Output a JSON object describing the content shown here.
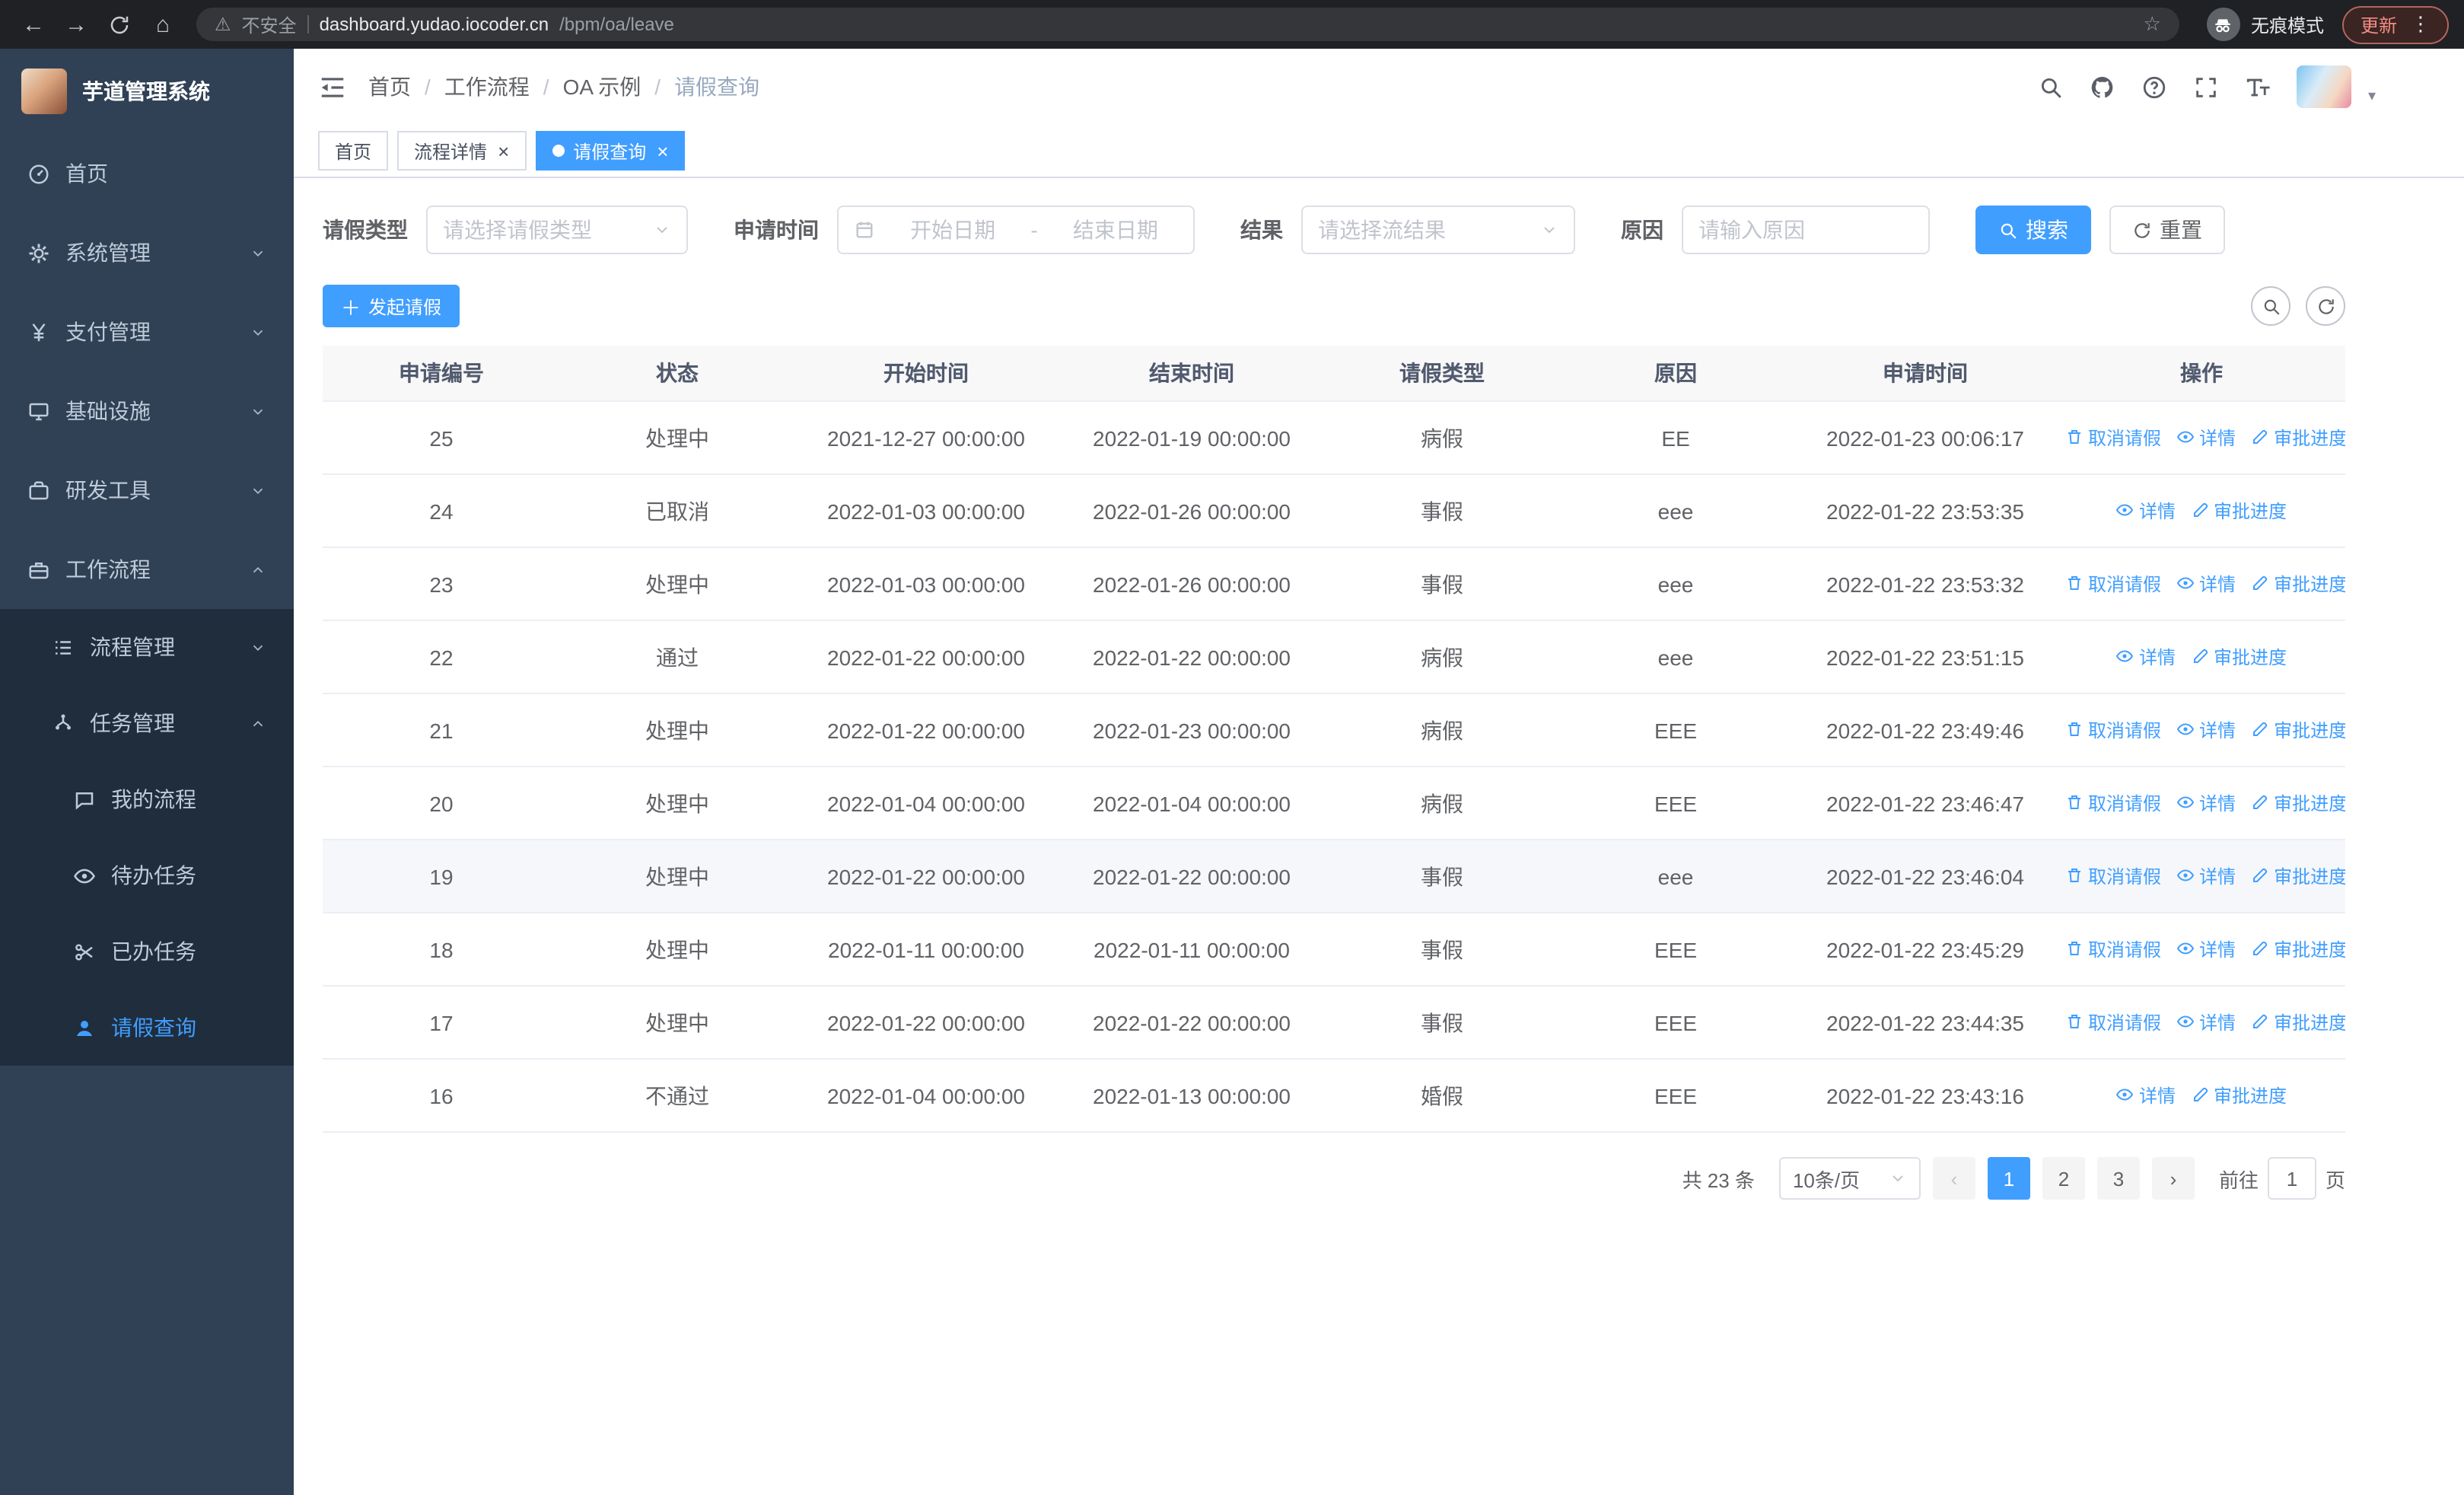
{
  "theme": {
    "primary": "#409eff",
    "sidebar_bg": "#304156",
    "sidebar_submenu_bg": "#1f2d3d",
    "sidebar_text": "#bfcbd9",
    "chrome_bg": "#202124",
    "update_badge_color": "#f28b82"
  },
  "browser": {
    "security_label": "不安全",
    "url_domain": "dashboard.yudao.iocoder.cn",
    "url_path": "/bpm/oa/leave",
    "incognito_label": "无痕模式",
    "update_label": "更新"
  },
  "sidebar": {
    "app_title": "芋道管理系统",
    "items": [
      {
        "label": "首页",
        "icon": "dashboard-icon",
        "level": 1
      },
      {
        "label": "系统管理",
        "icon": "gear-icon",
        "level": 1,
        "chevron": "down"
      },
      {
        "label": "支付管理",
        "icon": "yen-icon",
        "level": 1,
        "chevron": "down"
      },
      {
        "label": "基础设施",
        "icon": "infrastructure-icon",
        "level": 1,
        "chevron": "down"
      },
      {
        "label": "研发工具",
        "icon": "tools-icon",
        "level": 1,
        "chevron": "down"
      },
      {
        "label": "工作流程",
        "icon": "workflow-icon",
        "level": 1,
        "chevron": "up"
      },
      {
        "label": "流程管理",
        "icon": "process-icon",
        "level": 2,
        "chevron": "down"
      },
      {
        "label": "任务管理",
        "icon": "task-icon",
        "level": 2,
        "chevron": "up"
      },
      {
        "label": "我的流程",
        "icon": "chat-icon",
        "level": 3
      },
      {
        "label": "待办任务",
        "icon": "eye-icon",
        "level": 3
      },
      {
        "label": "已办任务",
        "icon": "scissors-icon",
        "level": 3
      },
      {
        "label": "请假查询",
        "icon": "user-icon",
        "level": 3,
        "active": true
      }
    ]
  },
  "header": {
    "breadcrumb": [
      "首页",
      "工作流程",
      "OA 示例",
      "请假查询"
    ]
  },
  "tabs": [
    {
      "label": "首页",
      "closable": false,
      "active": false
    },
    {
      "label": "流程详情",
      "closable": true,
      "active": false
    },
    {
      "label": "请假查询",
      "closable": true,
      "active": true
    }
  ],
  "filters": {
    "leave_type_label": "请假类型",
    "leave_type_placeholder": "请选择请假类型",
    "apply_time_label": "申请时间",
    "start_date_placeholder": "开始日期",
    "date_separator": "-",
    "end_date_placeholder": "结束日期",
    "result_label": "结果",
    "result_placeholder": "请选择流结果",
    "reason_label": "原因",
    "reason_placeholder": "请输入原因",
    "search_button": "搜索",
    "reset_button": "重置"
  },
  "toolbar": {
    "create_button": "发起请假"
  },
  "table": {
    "columns": [
      "申请编号",
      "状态",
      "开始时间",
      "结束时间",
      "请假类型",
      "原因",
      "申请时间",
      "操作"
    ],
    "rows": [
      {
        "id": "25",
        "status": "处理中",
        "start": "2021-12-27 00:00:00",
        "end": "2022-01-19 00:00:00",
        "type": "病假",
        "reason": "EE",
        "apply_time": "2022-01-23 00:06:17",
        "actions": [
          {
            "label": "取消请假",
            "icon": "trash-icon"
          },
          {
            "label": "详情",
            "icon": "detail-eye-icon"
          },
          {
            "label": "审批进度",
            "icon": "edit-icon"
          }
        ]
      },
      {
        "id": "24",
        "status": "已取消",
        "start": "2022-01-03 00:00:00",
        "end": "2022-01-26 00:00:00",
        "type": "事假",
        "reason": "eee",
        "apply_time": "2022-01-22 23:53:35",
        "actions": [
          {
            "label": "详情",
            "icon": "detail-eye-icon"
          },
          {
            "label": "审批进度",
            "icon": "edit-icon"
          }
        ]
      },
      {
        "id": "23",
        "status": "处理中",
        "start": "2022-01-03 00:00:00",
        "end": "2022-01-26 00:00:00",
        "type": "事假",
        "reason": "eee",
        "apply_time": "2022-01-22 23:53:32",
        "actions": [
          {
            "label": "取消请假",
            "icon": "trash-icon"
          },
          {
            "label": "详情",
            "icon": "detail-eye-icon"
          },
          {
            "label": "审批进度",
            "icon": "edit-icon"
          }
        ]
      },
      {
        "id": "22",
        "status": "通过",
        "start": "2022-01-22 00:00:00",
        "end": "2022-01-22 00:00:00",
        "type": "病假",
        "reason": "eee",
        "apply_time": "2022-01-22 23:51:15",
        "actions": [
          {
            "label": "详情",
            "icon": "detail-eye-icon"
          },
          {
            "label": "审批进度",
            "icon": "edit-icon"
          }
        ]
      },
      {
        "id": "21",
        "status": "处理中",
        "start": "2022-01-22 00:00:00",
        "end": "2022-01-23 00:00:00",
        "type": "病假",
        "reason": "EEE",
        "apply_time": "2022-01-22 23:49:46",
        "actions": [
          {
            "label": "取消请假",
            "icon": "trash-icon"
          },
          {
            "label": "详情",
            "icon": "detail-eye-icon"
          },
          {
            "label": "审批进度",
            "icon": "edit-icon"
          }
        ]
      },
      {
        "id": "20",
        "status": "处理中",
        "start": "2022-01-04 00:00:00",
        "end": "2022-01-04 00:00:00",
        "type": "病假",
        "reason": "EEE",
        "apply_time": "2022-01-22 23:46:47",
        "actions": [
          {
            "label": "取消请假",
            "icon": "trash-icon"
          },
          {
            "label": "详情",
            "icon": "detail-eye-icon"
          },
          {
            "label": "审批进度",
            "icon": "edit-icon"
          }
        ]
      },
      {
        "id": "19",
        "status": "处理中",
        "start": "2022-01-22 00:00:00",
        "end": "2022-01-22 00:00:00",
        "type": "事假",
        "reason": "eee",
        "apply_time": "2022-01-22 23:46:04",
        "highlighted": true,
        "actions": [
          {
            "label": "取消请假",
            "icon": "trash-icon"
          },
          {
            "label": "详情",
            "icon": "detail-eye-icon"
          },
          {
            "label": "审批进度",
            "icon": "edit-icon"
          }
        ]
      },
      {
        "id": "18",
        "status": "处理中",
        "start": "2022-01-11 00:00:00",
        "end": "2022-01-11 00:00:00",
        "type": "事假",
        "reason": "EEE",
        "apply_time": "2022-01-22 23:45:29",
        "actions": [
          {
            "label": "取消请假",
            "icon": "trash-icon"
          },
          {
            "label": "详情",
            "icon": "detail-eye-icon"
          },
          {
            "label": "审批进度",
            "icon": "edit-icon"
          }
        ]
      },
      {
        "id": "17",
        "status": "处理中",
        "start": "2022-01-22 00:00:00",
        "end": "2022-01-22 00:00:00",
        "type": "事假",
        "reason": "EEE",
        "apply_time": "2022-01-22 23:44:35",
        "actions": [
          {
            "label": "取消请假",
            "icon": "trash-icon"
          },
          {
            "label": "详情",
            "icon": "detail-eye-icon"
          },
          {
            "label": "审批进度",
            "icon": "edit-icon"
          }
        ]
      },
      {
        "id": "16",
        "status": "不通过",
        "start": "2022-01-04 00:00:00",
        "end": "2022-01-13 00:00:00",
        "type": "婚假",
        "reason": "EEE",
        "apply_time": "2022-01-22 23:43:16",
        "actions": [
          {
            "label": "详情",
            "icon": "detail-eye-icon"
          },
          {
            "label": "审批进度",
            "icon": "edit-icon"
          }
        ]
      }
    ]
  },
  "pagination": {
    "total_text": "共 23 条",
    "page_size_value": "10条/页",
    "pages": [
      "1",
      "2",
      "3"
    ],
    "active_page": "1",
    "goto_label": "前往",
    "goto_value": "1",
    "goto_unit": "页"
  }
}
